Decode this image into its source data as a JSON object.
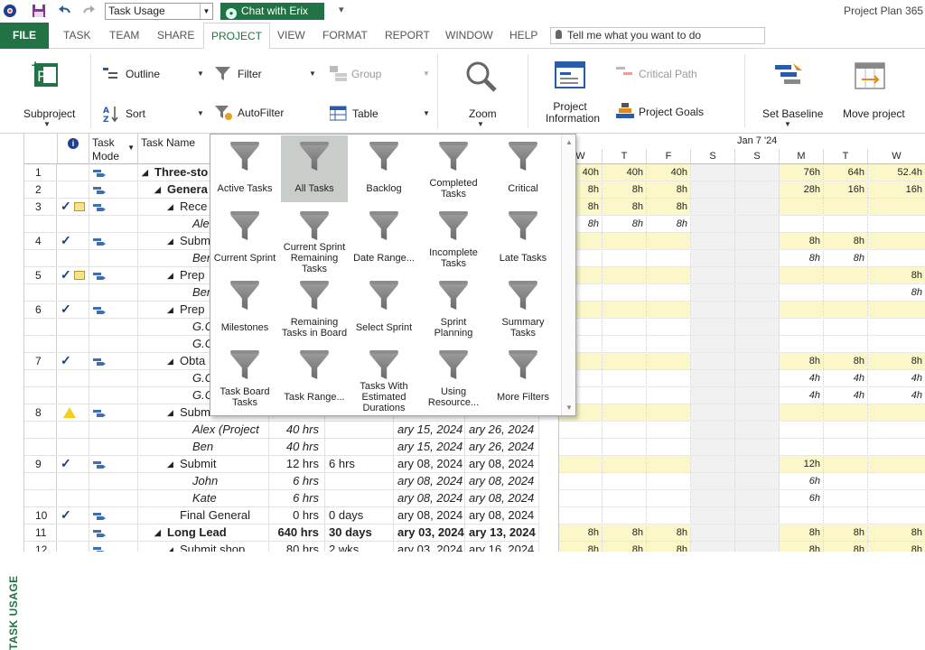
{
  "qat": {
    "view_value": "Task Usage",
    "chat_label": "Chat with Erix"
  },
  "app_title": "Project Plan 365 -",
  "tabs": [
    "FILE",
    "TASK",
    "TEAM",
    "SHARE",
    "PROJECT",
    "VIEW",
    "FORMAT",
    "REPORT",
    "WINDOW",
    "HELP"
  ],
  "tell_me": "Tell me what you want to do",
  "ribbon": {
    "subproject": "Subproject",
    "outline": "Outline",
    "sort": "Sort",
    "filter": "Filter",
    "autofilter": "AutoFilter",
    "group": "Group",
    "table": "Table",
    "zoom": "Zoom",
    "project_information": "Project Information",
    "critical_path": "Critical Path",
    "project_goals": "Project Goals",
    "set_baseline": "Set Baseline",
    "move_project": "Move project"
  },
  "sidebar_label": "TASK USAGE",
  "grid": {
    "headers": {
      "info": "ℹ",
      "task_mode": "Task Mode",
      "task_name": "Task Name"
    },
    "rows": [
      {
        "num": "1",
        "name": "Three-sto",
        "work": "",
        "dur": "",
        "start": "",
        "finish": "",
        "indent": 1,
        "bold": true,
        "italic": false,
        "summary": true,
        "check": false,
        "note": false,
        "warn": false,
        "mode": true
      },
      {
        "num": "2",
        "name": "Genera",
        "work": "",
        "dur": "",
        "start": "",
        "finish": "",
        "indent": 2,
        "bold": true,
        "italic": false,
        "summary": true,
        "check": false,
        "note": false,
        "warn": false,
        "mode": true
      },
      {
        "num": "3",
        "name": "Rece",
        "work": "",
        "dur": "",
        "start": "",
        "finish": "",
        "indent": 3,
        "bold": false,
        "italic": false,
        "summary": true,
        "check": true,
        "note": true,
        "warn": false,
        "mode": true
      },
      {
        "num": "",
        "name": "Ale",
        "work": "",
        "dur": "",
        "start": "",
        "finish": "",
        "indent": 4,
        "bold": false,
        "italic": true,
        "summary": false,
        "check": false,
        "note": false,
        "warn": false,
        "mode": false
      },
      {
        "num": "4",
        "name": "Subm",
        "work": "",
        "dur": "",
        "start": "",
        "finish": "",
        "indent": 3,
        "bold": false,
        "italic": false,
        "summary": true,
        "check": true,
        "note": false,
        "warn": false,
        "mode": true
      },
      {
        "num": "",
        "name": "Ber",
        "work": "",
        "dur": "",
        "start": "",
        "finish": "",
        "indent": 4,
        "bold": false,
        "italic": true,
        "summary": false,
        "check": false,
        "note": false,
        "warn": false,
        "mode": false
      },
      {
        "num": "5",
        "name": "Prep",
        "work": "",
        "dur": "",
        "start": "",
        "finish": "",
        "indent": 3,
        "bold": false,
        "italic": false,
        "summary": true,
        "check": true,
        "note": true,
        "warn": false,
        "mode": true
      },
      {
        "num": "",
        "name": "Ber",
        "work": "",
        "dur": "",
        "start": "",
        "finish": "",
        "indent": 4,
        "bold": false,
        "italic": true,
        "summary": false,
        "check": false,
        "note": false,
        "warn": false,
        "mode": false
      },
      {
        "num": "6",
        "name": "Prep",
        "work": "",
        "dur": "",
        "start": "",
        "finish": "",
        "indent": 3,
        "bold": false,
        "italic": false,
        "summary": true,
        "check": true,
        "note": false,
        "warn": false,
        "mode": true
      },
      {
        "num": "",
        "name": "G.C",
        "work": "",
        "dur": "",
        "start": "",
        "finish": "",
        "indent": 4,
        "bold": false,
        "italic": true,
        "summary": false,
        "check": false,
        "note": false,
        "warn": false,
        "mode": false
      },
      {
        "num": "",
        "name": "G.C",
        "work": "",
        "dur": "",
        "start": "",
        "finish": "",
        "indent": 4,
        "bold": false,
        "italic": true,
        "summary": false,
        "check": false,
        "note": false,
        "warn": false,
        "mode": false
      },
      {
        "num": "7",
        "name": "Obta",
        "work": "",
        "dur": "",
        "start": "",
        "finish": "",
        "indent": 3,
        "bold": false,
        "italic": false,
        "summary": true,
        "check": true,
        "note": false,
        "warn": false,
        "mode": true
      },
      {
        "num": "",
        "name": "G.C",
        "work": "",
        "dur": "",
        "start": "",
        "finish": "",
        "indent": 4,
        "bold": false,
        "italic": true,
        "summary": false,
        "check": false,
        "note": false,
        "warn": false,
        "mode": false
      },
      {
        "num": "",
        "name": "G.C",
        "work": "",
        "dur": "",
        "start": "",
        "finish": "",
        "indent": 4,
        "bold": false,
        "italic": true,
        "summary": false,
        "check": false,
        "note": false,
        "warn": false,
        "mode": false
      },
      {
        "num": "8",
        "name": "Subm",
        "work": "",
        "dur": "",
        "start": "",
        "finish": "",
        "indent": 3,
        "bold": false,
        "italic": false,
        "summary": true,
        "check": false,
        "note": false,
        "warn": true,
        "mode": true
      },
      {
        "num": "",
        "name": "Alex (Project",
        "work": "40 hrs",
        "dur": "",
        "start": "ary 15, 2024",
        "finish": "ary 26, 2024",
        "indent": 4,
        "bold": false,
        "italic": true,
        "summary": false,
        "check": false,
        "note": false,
        "warn": false,
        "mode": false
      },
      {
        "num": "",
        "name": "Ben",
        "work": "40 hrs",
        "dur": "",
        "start": "ary 15, 2024",
        "finish": "ary 26, 2024",
        "indent": 4,
        "bold": false,
        "italic": true,
        "summary": false,
        "check": false,
        "note": false,
        "warn": false,
        "mode": false
      },
      {
        "num": "9",
        "name": "Submit",
        "work": "12 hrs",
        "dur": "6 hrs",
        "start": "ary 08, 2024",
        "finish": "ary 08, 2024",
        "indent": 3,
        "bold": false,
        "italic": false,
        "summary": true,
        "check": true,
        "note": false,
        "warn": false,
        "mode": true
      },
      {
        "num": "",
        "name": "John",
        "work": "6 hrs",
        "dur": "",
        "start": "ary 08, 2024",
        "finish": "ary 08, 2024",
        "indent": 4,
        "bold": false,
        "italic": true,
        "summary": false,
        "check": false,
        "note": false,
        "warn": false,
        "mode": false
      },
      {
        "num": "",
        "name": "Kate",
        "work": "6 hrs",
        "dur": "",
        "start": "ary 08, 2024",
        "finish": "ary 08, 2024",
        "indent": 4,
        "bold": false,
        "italic": true,
        "summary": false,
        "check": false,
        "note": false,
        "warn": false,
        "mode": false
      },
      {
        "num": "10",
        "name": "Final General",
        "work": "0 hrs",
        "dur": "0 days",
        "start": "ary 08, 2024",
        "finish": "ary 08, 2024",
        "indent": 3,
        "bold": false,
        "italic": false,
        "summary": false,
        "check": true,
        "note": false,
        "warn": false,
        "mode": true
      },
      {
        "num": "11",
        "name": "Long Lead",
        "work": "640 hrs",
        "dur": "30 days",
        "start": "ary 03, 2024",
        "finish": "ary 13, 2024",
        "indent": 2,
        "bold": true,
        "italic": false,
        "summary": true,
        "check": false,
        "note": false,
        "warn": false,
        "mode": true
      },
      {
        "num": "12",
        "name": "Submit shop",
        "work": "80 hrs",
        "dur": "2 wks",
        "start": "ary 03, 2024",
        "finish": "ary 16, 2024",
        "indent": 3,
        "bold": false,
        "italic": false,
        "summary": true,
        "check": false,
        "note": false,
        "warn": false,
        "mode": true
      }
    ]
  },
  "gantt": {
    "week_label": "Jan 7 '24",
    "days": [
      "W",
      "T",
      "F",
      "S",
      "S",
      "M",
      "T",
      "W"
    ],
    "rows": [
      [
        "40h",
        "40h",
        "40h",
        "",
        "",
        "76h",
        "64h",
        "52.4h"
      ],
      [
        "8h",
        "8h",
        "8h",
        "",
        "",
        "28h",
        "16h",
        "16h"
      ],
      [
        "8h",
        "8h",
        "8h",
        "",
        "",
        "",
        "",
        ""
      ],
      [
        "8h",
        "8h",
        "8h",
        "",
        "",
        "",
        "",
        ""
      ],
      [
        "",
        "",
        "",
        "",
        "",
        "8h",
        "8h",
        ""
      ],
      [
        "",
        "",
        "",
        "",
        "",
        "8h",
        "8h",
        ""
      ],
      [
        "",
        "",
        "",
        "",
        "",
        "",
        "",
        "8h"
      ],
      [
        "",
        "",
        "",
        "",
        "",
        "",
        "",
        "8h"
      ],
      [
        "",
        "",
        "",
        "",
        "",
        "",
        "",
        ""
      ],
      [
        "",
        "",
        "",
        "",
        "",
        "",
        "",
        ""
      ],
      [
        "",
        "",
        "",
        "",
        "",
        "",
        "",
        ""
      ],
      [
        "",
        "",
        "",
        "",
        "",
        "8h",
        "8h",
        "8h"
      ],
      [
        "",
        "",
        "",
        "",
        "",
        "4h",
        "4h",
        "4h"
      ],
      [
        "",
        "",
        "",
        "",
        "",
        "4h",
        "4h",
        "4h"
      ],
      [
        "",
        "",
        "",
        "",
        "",
        "",
        "",
        ""
      ],
      [
        "",
        "",
        "",
        "",
        "",
        "",
        "",
        ""
      ],
      [
        "",
        "",
        "",
        "",
        "",
        "",
        "",
        ""
      ],
      [
        "",
        "",
        "",
        "",
        "",
        "12h",
        "",
        ""
      ],
      [
        "",
        "",
        "",
        "",
        "",
        "6h",
        "",
        ""
      ],
      [
        "",
        "",
        "",
        "",
        "",
        "6h",
        "",
        ""
      ],
      [
        "",
        "",
        "",
        "",
        "",
        "",
        "",
        ""
      ],
      [
        "8h",
        "8h",
        "8h",
        "",
        "",
        "8h",
        "8h",
        "8h"
      ],
      [
        "8h",
        "8h",
        "8h",
        "",
        "",
        "8h",
        "8h",
        "8h"
      ]
    ]
  },
  "filter_popup": {
    "items": [
      "Active Tasks",
      "All Tasks",
      "Backlog",
      "Completed Tasks",
      "Critical",
      "Current Sprint",
      "Current Sprint Remaining Tasks",
      "Date Range...",
      "Incomplete Tasks",
      "Late Tasks",
      "Milestones",
      "Remaining Tasks in Board",
      "Select Sprint",
      "Sprint Planning",
      "Summary Tasks",
      "Task Board Tasks",
      "Task Range...",
      "Tasks With Estimated Durations",
      "Using Resource...",
      "More Filters"
    ],
    "selected": "All Tasks"
  },
  "colors": {
    "accent": "#217346",
    "grid_yellow": "#fbf7c8",
    "weekend": "#f1f1f1"
  }
}
